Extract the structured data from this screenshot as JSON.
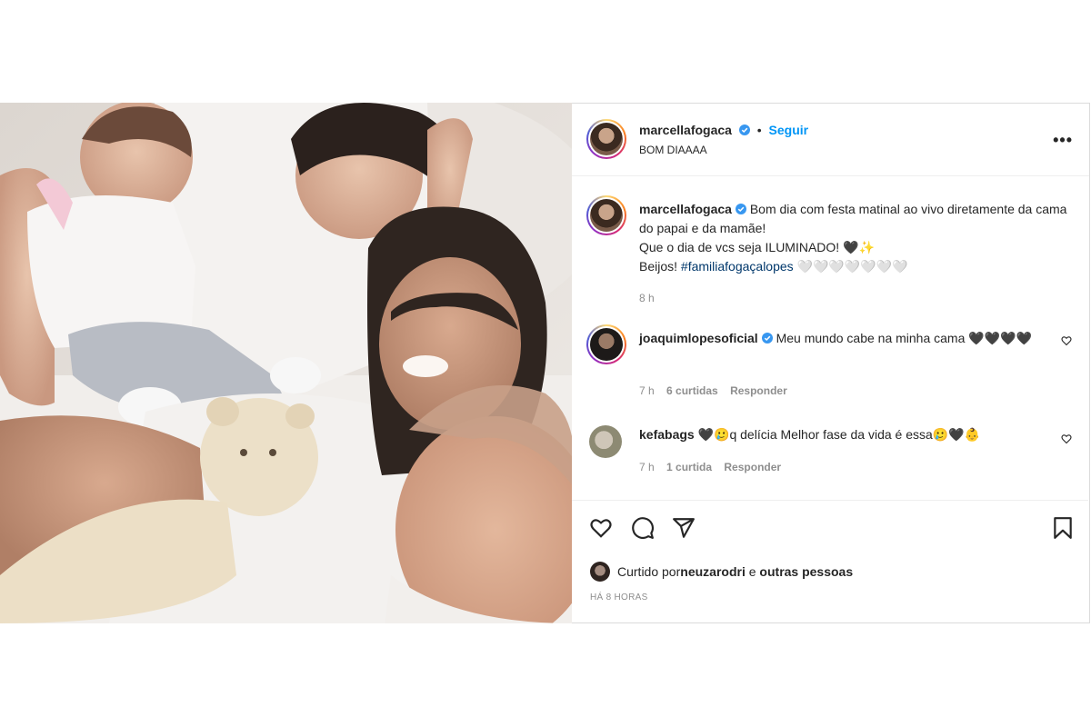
{
  "post": {
    "author": "marcellafogaca",
    "follow_label": "Seguir",
    "dot": "•",
    "location": "BOM DIAAAA",
    "more_label": "•••",
    "caption": {
      "author": "marcellafogaca",
      "line1": "Bom dia com festa matinal ao vivo diretamente da cama do papai e da mamãe!",
      "line2": "Que o dia de vcs seja ILUMINADO! 🖤✨",
      "line3_prefix": "Beijos! ",
      "hashtag": "#familiafogaçalopes",
      "line3_suffix": " 🤍🤍🤍🤍🤍🤍🤍",
      "time": "8 h"
    },
    "comments": [
      {
        "author": "joaquimlopesoficial",
        "verified": true,
        "text": "Meu mundo cabe na minha cama 🖤🖤🖤🖤",
        "time": "7 h",
        "likes": "6 curtidas",
        "reply": "Responder"
      },
      {
        "author": "kefabags",
        "verified": false,
        "text": "🖤🥲q delícia Melhor fase da vida é essa🥲🖤👶",
        "time": "7 h",
        "likes": "1 curtida",
        "reply": "Responder"
      }
    ],
    "liked_by_prefix": "Curtido por ",
    "liked_by_user": "neuzarodri",
    "liked_by_mid": " e ",
    "liked_by_others": "outras pessoas",
    "posted_ago": "HÁ 8 HORAS"
  },
  "colors": {
    "link": "#0095f6",
    "hashtag": "#00376b",
    "muted": "#8e8e8e"
  },
  "icons": [
    "heart-icon",
    "comment-icon",
    "share-icon",
    "bookmark-icon",
    "verified-badge-icon",
    "more-options-icon"
  ]
}
